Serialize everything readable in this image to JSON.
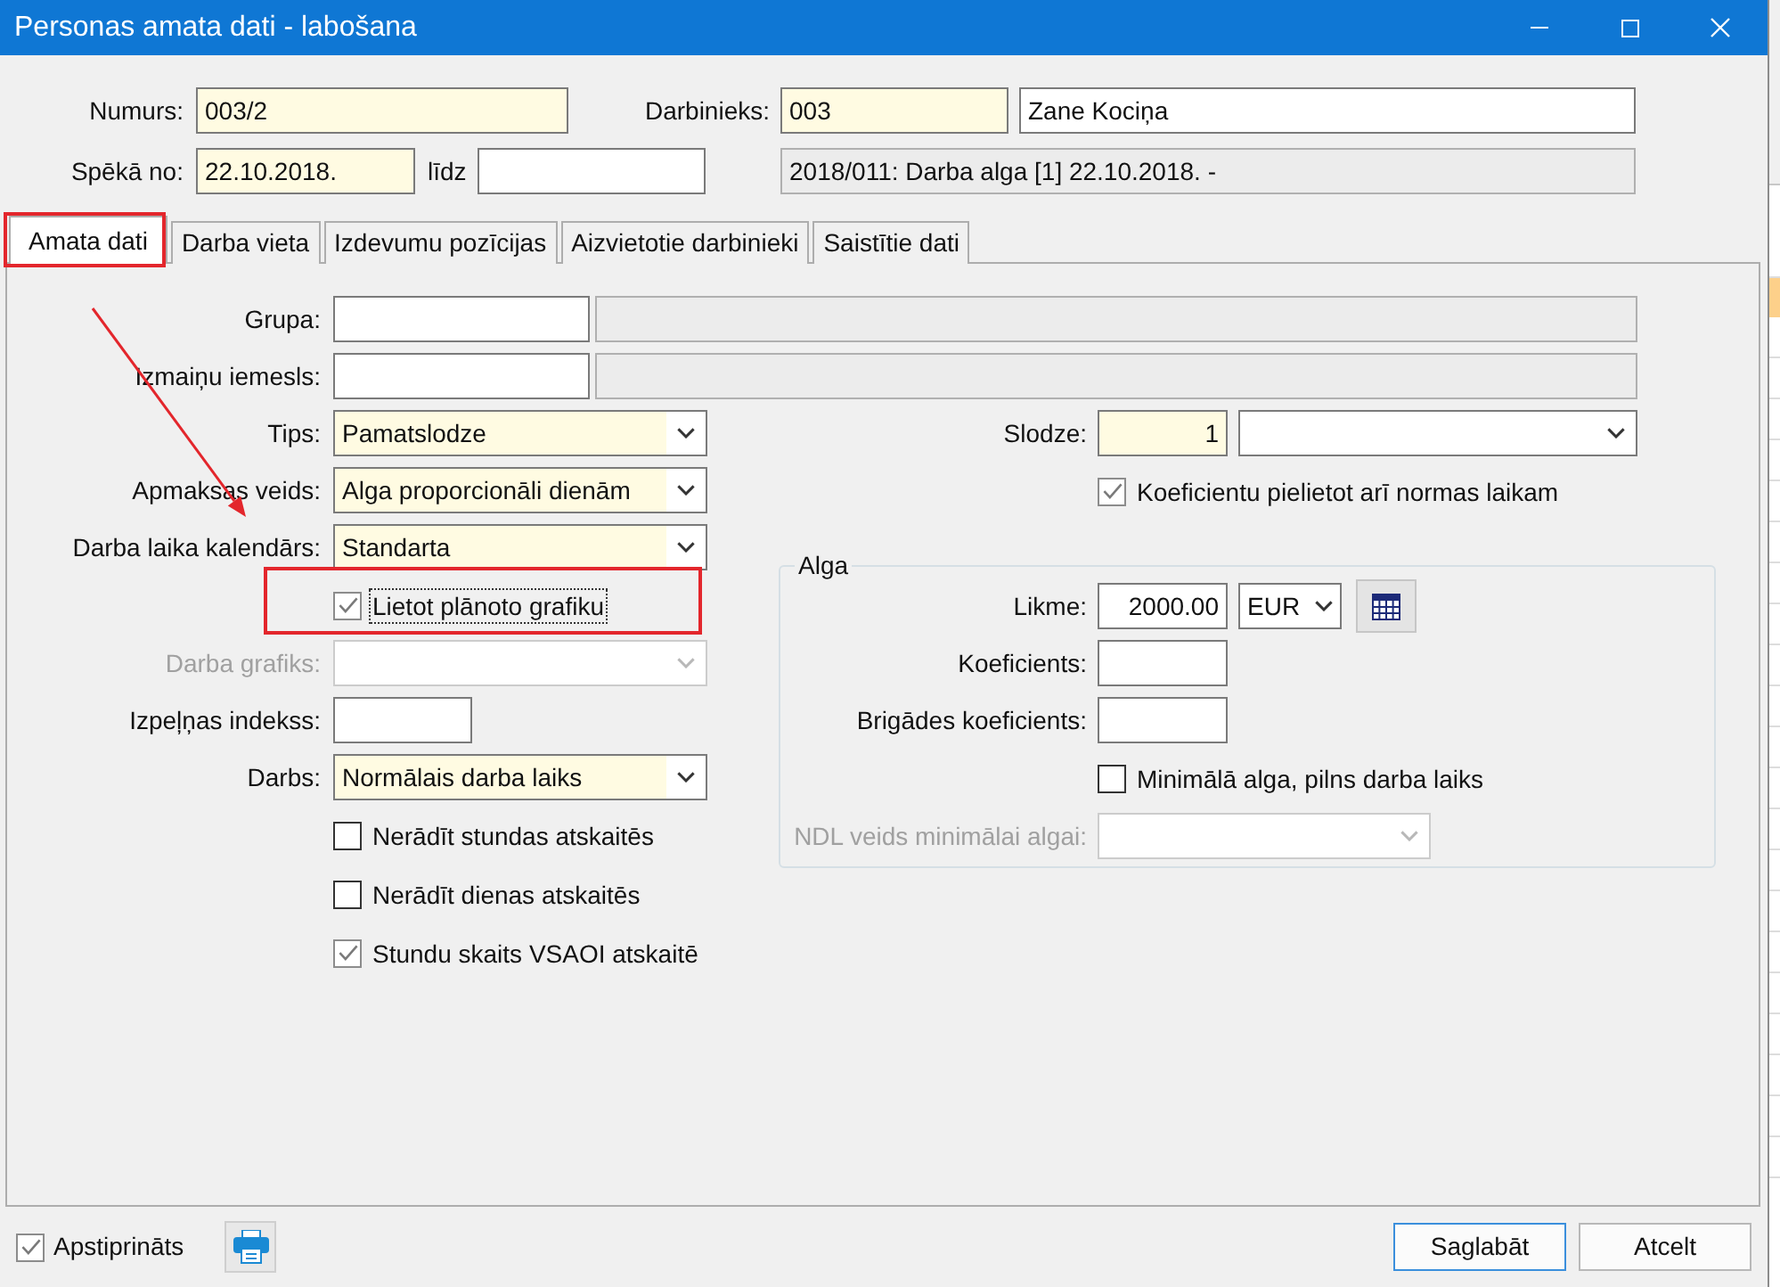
{
  "window": {
    "title": "Personas amata dati - labošana"
  },
  "header": [
    {
      "label": "Numurs:",
      "fields": [
        {
          "value": "003/2",
          "required": true,
          "readonly": false
        }
      ]
    },
    {
      "label": "Darbinieks:",
      "fields": [
        {
          "value": "003",
          "required": true,
          "readonly": false
        },
        {
          "value": "Zane Kociņa",
          "required": false,
          "readonly": false
        }
      ]
    },
    {
      "label": "Spēkā no:",
      "fields": [
        {
          "value": "22.10.2018.",
          "required": true,
          "readonly": false
        }
      ]
    },
    {
      "label": "līdz",
      "fields": [
        {
          "required": false,
          "readonly": false
        }
      ]
    },
    {
      "fields": [
        {
          "value": "2018/011: Darba alga [1] 22.10.2018. -",
          "required": false,
          "readonly": true
        }
      ]
    }
  ],
  "tabs": [
    {
      "label": "Amata dati",
      "selected": true
    },
    {
      "label": "Darba vieta",
      "selected": false
    },
    {
      "label": "Izdevumu pozīcijas",
      "selected": false
    },
    {
      "label": "Aizvietotie darbinieki",
      "selected": false
    },
    {
      "label": "Saistītie dati",
      "selected": false
    }
  ],
  "lookup_rows": [
    {
      "label": "Grupa:",
      "required": false
    },
    {
      "label": "Izmaiņu iemesls:",
      "required": false
    }
  ],
  "left_column": [
    {
      "kind": "select",
      "label": "Tips:",
      "value": "Pamatslodze",
      "required": true,
      "disabled": false
    },
    {
      "kind": "select",
      "label": "Apmaksas veids:",
      "value": "Alga proporcionāli dienām",
      "required": true,
      "disabled": false
    },
    {
      "kind": "select",
      "label": "Darba laika kalendārs:",
      "value": "Standarta",
      "required": true,
      "disabled": false
    },
    {
      "kind": "checkbox",
      "label": "Lietot plānoto grafiku",
      "checked": true,
      "focused": true,
      "disabled": false
    },
    {
      "kind": "select",
      "label": "Darba grafiks:",
      "required": false,
      "disabled": true
    },
    {
      "kind": "text",
      "label": "Izpeļņas indekss:",
      "required": false,
      "disabled": false
    },
    {
      "kind": "select",
      "label": "Darbs:",
      "value": "Normālais darba laiks",
      "required": true,
      "disabled": false
    },
    {
      "kind": "checkbox",
      "label": "Nerādīt stundas atskaitēs",
      "checked": false,
      "focused": false,
      "disabled": false
    },
    {
      "kind": "checkbox",
      "label": "Nerādīt dienas atskaitēs",
      "checked": false,
      "focused": false,
      "disabled": false
    },
    {
      "kind": "checkbox",
      "label": "Stundu skaits VSAOI atskaitē",
      "checked": true,
      "focused": false,
      "disabled": false
    }
  ],
  "right_column": [
    {
      "kind": "number_unit",
      "label": "Slodze:",
      "value": "1",
      "required": true,
      "disabled": false
    },
    {
      "kind": "checkbox",
      "label": "Koeficientu pielietot arī normas laikam",
      "checked": true,
      "focused": false,
      "disabled": false
    }
  ],
  "salary_group": {
    "title": "Alga",
    "rows": [
      {
        "kind": "amount",
        "label": "Likme:",
        "value": "2000.00",
        "currency": "EUR",
        "required": false,
        "disabled": false
      },
      {
        "kind": "number",
        "label": "Koeficients:",
        "required": false,
        "disabled": false
      },
      {
        "kind": "number",
        "label": "Brigādes koeficients:",
        "required": false,
        "disabled": false
      },
      {
        "kind": "checkbox",
        "label": "Minimālā alga, pilns darba laiks",
        "checked": false,
        "focused": false,
        "disabled": false
      },
      {
        "kind": "select",
        "label": "NDL veids minimālai algai:",
        "required": false,
        "disabled": true
      }
    ]
  },
  "bottom_bar": {
    "approved": {
      "label": "Apstiprināts",
      "checked": true
    },
    "buttons": [
      {
        "label": "Saglabāt",
        "default": true
      },
      {
        "label": "Atcelt",
        "default": false
      }
    ]
  }
}
